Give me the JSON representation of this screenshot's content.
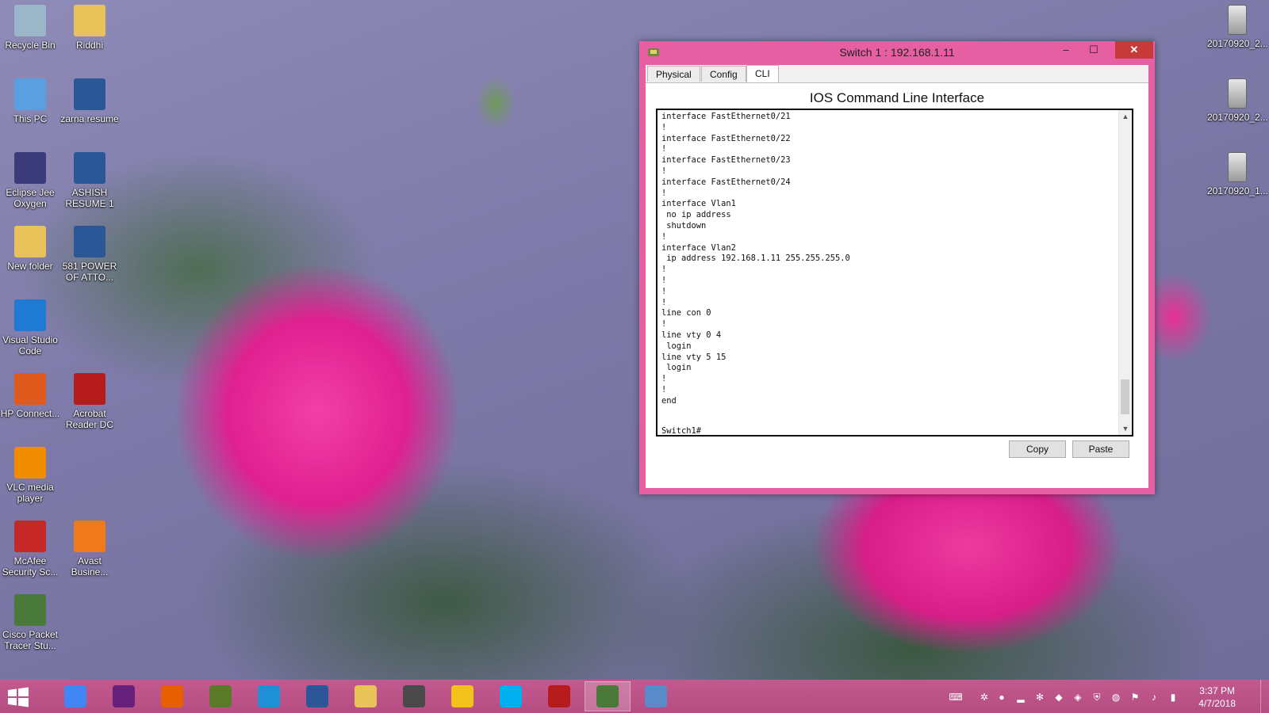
{
  "desktop": {
    "left_icons": [
      {
        "label": "Recycle Bin",
        "icon": "recycle-bin-icon",
        "color": "#9bb6c8"
      },
      {
        "label": "Riddhi",
        "icon": "folder-icon",
        "color": "#e8c35a"
      },
      {
        "label": "This PC",
        "icon": "computer-icon",
        "color": "#5aa0e0"
      },
      {
        "label": "zarna resume",
        "icon": "word-doc-icon",
        "color": "#2b5797"
      },
      {
        "label": "Eclipse Jee Oxygen",
        "icon": "eclipse-icon",
        "color": "#3b3a7a"
      },
      {
        "label": "ASHISH RESUME 1",
        "icon": "word-doc-icon",
        "color": "#2b5797"
      },
      {
        "label": "New folder",
        "icon": "folder-icon",
        "color": "#e8c35a"
      },
      {
        "label": "581 POWER OF ATTO...",
        "icon": "word-doc-icon",
        "color": "#2b5797"
      },
      {
        "label": "Visual Studio Code",
        "icon": "vscode-icon",
        "color": "#1e7ad2"
      },
      {
        "label": "HP Connect...",
        "icon": "hp-connect-icon",
        "color": "#e05a1e"
      },
      {
        "label": "Acrobat Reader DC",
        "icon": "acrobat-icon",
        "color": "#b71c1c"
      },
      {
        "label": "VLC media player",
        "icon": "vlc-icon",
        "color": "#f08c00"
      },
      {
        "label": "McAfee Security Sc...",
        "icon": "mcafee-icon",
        "color": "#c62828"
      },
      {
        "label": "Avast Busine...",
        "icon": "avast-icon",
        "color": "#f07a1a"
      },
      {
        "label": "Cisco Packet Tracer Stu...",
        "icon": "packet-tracer-icon",
        "color": "#4a7a3a"
      }
    ],
    "right_icons": [
      {
        "label": "20170920_2...",
        "icon": "image-file-icon"
      },
      {
        "label": "20170920_2...",
        "icon": "image-file-icon"
      },
      {
        "label": "20170920_1...",
        "icon": "image-file-icon"
      }
    ]
  },
  "window": {
    "title": "Switch 1 : 192.168.1.11",
    "minimize_glyph": "–",
    "maximize_glyph": "☐",
    "close_glyph": "✕",
    "tabs": [
      {
        "label": "Physical"
      },
      {
        "label": "Config"
      },
      {
        "label": "CLI",
        "active": true
      }
    ],
    "cli_title": "IOS Command Line Interface",
    "terminal_lines": [
      "interface FastEthernet0/21",
      "!",
      "interface FastEthernet0/22",
      "!",
      "interface FastEthernet0/23",
      "!",
      "interface FastEthernet0/24",
      "!",
      "interface Vlan1",
      " no ip address",
      " shutdown",
      "!",
      "interface Vlan2",
      " ip address 192.168.1.11 255.255.255.0",
      "!",
      "!",
      "!",
      "!",
      "line con 0",
      "!",
      "line vty 0 4",
      " login",
      "line vty 5 15",
      " login",
      "!",
      "!",
      "end"
    ],
    "prompt": "Switch1#",
    "copy_label": "Copy",
    "paste_label": "Paste"
  },
  "taskbar": {
    "items": [
      {
        "icon": "chrome-icon",
        "color": "#4285f4"
      },
      {
        "icon": "visual-studio-icon",
        "color": "#68217a"
      },
      {
        "icon": "firefox-icon",
        "color": "#e66000"
      },
      {
        "icon": "snipping-tool-icon",
        "color": "#5a7a2a"
      },
      {
        "icon": "internet-explorer-icon",
        "color": "#1e90d6"
      },
      {
        "icon": "word-icon",
        "color": "#2b5797"
      },
      {
        "icon": "file-explorer-icon",
        "color": "#e8c35a"
      },
      {
        "icon": "sublime-icon",
        "color": "#4a4a4a"
      },
      {
        "icon": "duck-icon",
        "color": "#f2c21b"
      },
      {
        "icon": "skype-icon",
        "color": "#00aff0"
      },
      {
        "icon": "acrobat-icon",
        "color": "#b71c1c"
      },
      {
        "icon": "packet-tracer-icon",
        "color": "#4a7a3a",
        "active": true
      },
      {
        "icon": "paint-icon",
        "color": "#5a8ac8"
      }
    ],
    "clock_time": "3:37 PM",
    "clock_date": "4/7/2018"
  },
  "colors": {
    "window_frame": "#e75fa3",
    "taskbar": "#b54d82"
  }
}
